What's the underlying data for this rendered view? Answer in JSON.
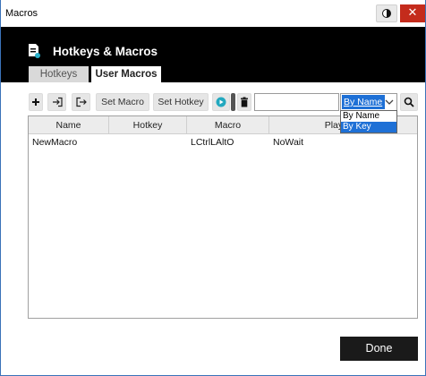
{
  "window": {
    "title": "Macros"
  },
  "header": {
    "title": "Hotkeys & Macros",
    "icon": "document-macro-icon"
  },
  "tabs": [
    {
      "label": "Hotkeys",
      "selected": false
    },
    {
      "label": "User Macros",
      "selected": true
    }
  ],
  "toolbar": {
    "add_icon": "plus-icon",
    "import_icon": "import-icon",
    "export_icon": "export-icon",
    "set_macro_label": "Set Macro",
    "set_hotkey_label": "Set Hotkey",
    "play_icon": "play-icon",
    "delete_icon": "trash-icon",
    "search_value": "",
    "sort_selected": "By Name",
    "sort_options": [
      "By Name",
      "By Key"
    ],
    "sort_highlighted": "By Key",
    "search_icon": "magnifier-icon"
  },
  "table": {
    "columns": [
      "Name",
      "Hotkey",
      "Macro",
      "Playback"
    ],
    "rows": [
      {
        "name": "NewMacro",
        "hotkey": "",
        "macro": "LCtrlLAltO",
        "playback": "NoWait"
      }
    ]
  },
  "footer": {
    "done_label": "Done"
  },
  "colors": {
    "accent": "#1e70d6",
    "header_bg": "#000000",
    "close_red": "#c42b1c"
  }
}
